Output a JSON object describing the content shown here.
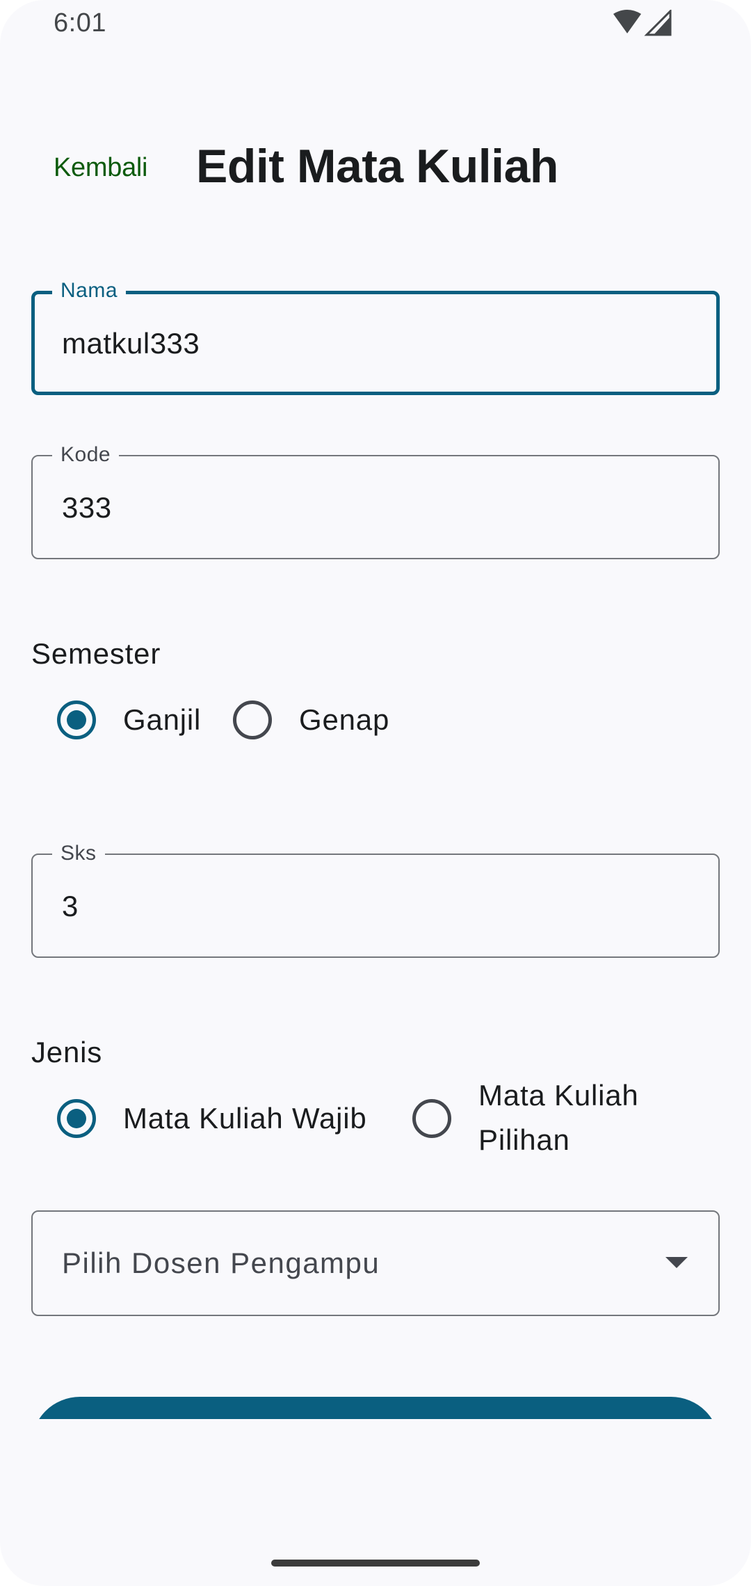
{
  "status_bar": {
    "time": "6:01",
    "icons": [
      "wifi-icon",
      "cell-signal-icon"
    ]
  },
  "header": {
    "back_label": "Kembali",
    "title": "Edit Mata Kuliah"
  },
  "form": {
    "nama": {
      "label": "Nama",
      "value": "matkul333"
    },
    "kode": {
      "label": "Kode",
      "value": "333"
    },
    "semester": {
      "label": "Semester",
      "options": [
        "Ganjil",
        "Genap"
      ],
      "selected": "Ganjil"
    },
    "sks": {
      "label": "Sks",
      "value": "3"
    },
    "jenis": {
      "label": "Jenis",
      "options": [
        "Mata Kuliah Wajib",
        "Mata Kuliah Pilihan"
      ],
      "selected": "Mata Kuliah Wajib"
    },
    "dosen": {
      "placeholder": "Pilih Dosen Pengampu",
      "icon": "arrow-drop-down-icon"
    }
  },
  "colors": {
    "primary": "#0a5f80",
    "back_link": "#0d5b0d",
    "background": "#f9f9fc",
    "outline": "#74777c"
  }
}
